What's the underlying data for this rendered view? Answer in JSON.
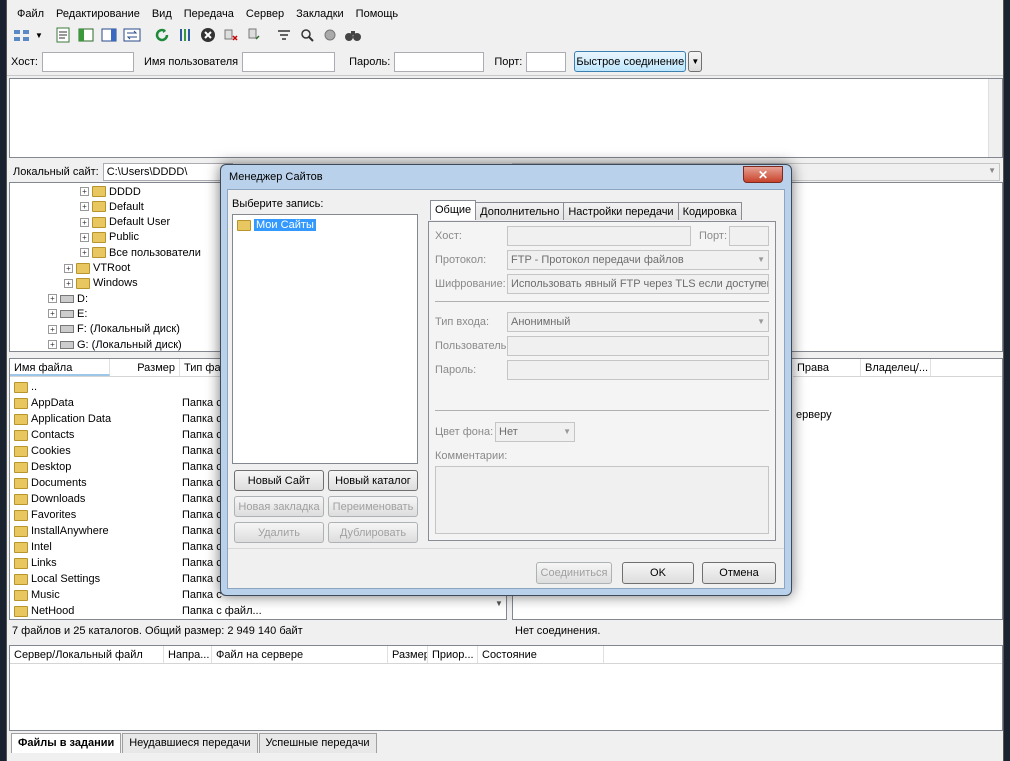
{
  "menu": [
    "Файл",
    "Редактирование",
    "Вид",
    "Передача",
    "Сервер",
    "Закладки",
    "Помощь"
  ],
  "toolbar_icons": [
    "site-manager-icon",
    "dropdown-arrow-icon",
    "message-log-icon",
    "local-tree-icon",
    "remote-tree-icon",
    "queue-icon",
    "refresh-icon",
    "process-queue-icon",
    "cancel-icon",
    "disconnect-icon",
    "reconnect-icon",
    "directory-listing-filters-icon",
    "toggle-sync-browsing-icon",
    "dir-compare-icon",
    "search-icon"
  ],
  "quickconnect": {
    "host_label": "Хост:",
    "user_label": "Имя пользователя",
    "pass_label": "Пароль:",
    "port_label": "Порт:",
    "connect_button": "Быстрое соединение"
  },
  "local": {
    "path_label": "Локальный сайт:",
    "path_value": "C:\\Users\\DDDD\\",
    "tree": [
      {
        "label": "DDDD",
        "type": "folder",
        "level": 2
      },
      {
        "label": "Default",
        "type": "folder",
        "level": 2
      },
      {
        "label": "Default User",
        "type": "folder",
        "level": 2
      },
      {
        "label": "Public",
        "type": "folder",
        "level": 2
      },
      {
        "label": "Все пользователи",
        "type": "folder",
        "level": 2
      },
      {
        "label": "VTRoot",
        "type": "folder",
        "level": 1
      },
      {
        "label": "Windows",
        "type": "folder",
        "level": 1
      },
      {
        "label": "D:",
        "type": "drive",
        "level": 0
      },
      {
        "label": "E:",
        "type": "drive",
        "level": 0
      },
      {
        "label": "F: (Локальный диск)",
        "type": "drive",
        "level": 0
      },
      {
        "label": "G: (Локальный диск)",
        "type": "drive",
        "level": 0
      }
    ],
    "columns": [
      "Имя файла",
      "Размер",
      "Тип фай"
    ],
    "files": [
      {
        "name": "..",
        "type": ""
      },
      {
        "name": "AppData",
        "type": "Папка с"
      },
      {
        "name": "Application Data",
        "type": "Папка с"
      },
      {
        "name": "Contacts",
        "type": "Папка с"
      },
      {
        "name": "Cookies",
        "type": "Папка с"
      },
      {
        "name": "Desktop",
        "type": "Папка с"
      },
      {
        "name": "Documents",
        "type": "Папка с"
      },
      {
        "name": "Downloads",
        "type": "Папка с"
      },
      {
        "name": "Favorites",
        "type": "Папка с"
      },
      {
        "name": "InstallAnywhere",
        "type": "Папка с"
      },
      {
        "name": "Intel",
        "type": "Папка с"
      },
      {
        "name": "Links",
        "type": "Папка с"
      },
      {
        "name": "Local Settings",
        "type": "Папка с"
      },
      {
        "name": "Music",
        "type": "Папка с"
      },
      {
        "name": "NetHood",
        "type": "Папка с файл..."
      }
    ],
    "status": "7 файлов и 25 каталогов. Общий размер: 2 949 140 байт"
  },
  "remote": {
    "columns": [
      "Права",
      "Владелец/..."
    ],
    "note": "ерверу",
    "status": "Нет соединения."
  },
  "queue": {
    "columns": [
      "Сервер/Локальный файл",
      "Напра...",
      "Файл на сервере",
      "Размер",
      "Приор...",
      "Состояние"
    ],
    "tabs": [
      "Файлы в задании",
      "Неудавшиеся передачи",
      "Успешные передачи"
    ]
  },
  "dialog": {
    "title": "Менеджер Сайтов",
    "close": "✕",
    "select_label": "Выберите запись:",
    "tree_root": "Мои Сайты",
    "buttons": {
      "new_site": "Новый Сайт",
      "new_folder": "Новый каталог",
      "new_bookmark": "Новая закладка",
      "rename": "Переименовать",
      "delete": "Удалить",
      "duplicate": "Дублировать",
      "connect": "Соединиться",
      "ok": "OK",
      "cancel": "Отмена"
    },
    "tabs": [
      "Общие",
      "Дополнительно",
      "Настройки передачи",
      "Кодировка"
    ],
    "general": {
      "host_label": "Хост:",
      "port_label": "Порт:",
      "protocol_label": "Протокол:",
      "protocol_value": "FTP - Протокол передачи файлов",
      "encryption_label": "Шифрование:",
      "encryption_value": "Использовать явный FTP через TLS если доступен",
      "logon_label": "Тип входа:",
      "logon_value": "Анонимный",
      "user_label": "Пользователь:",
      "password_label": "Пароль:",
      "bgcolor_label": "Цвет фона:",
      "bgcolor_value": "Нет",
      "comments_label": "Комментарии:"
    }
  },
  "colors": {
    "accent": "#3399ff",
    "folder": "#e8c660",
    "dialog_frame": "#b9d1ea"
  }
}
